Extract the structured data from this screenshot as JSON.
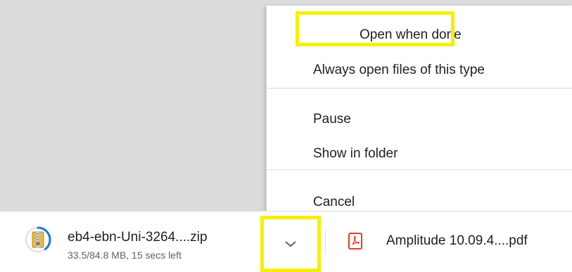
{
  "context_menu": {
    "items": [
      {
        "label": "Open when done"
      },
      {
        "label": "Always open files of this type"
      },
      {
        "label": "Pause"
      },
      {
        "label": "Show in folder"
      },
      {
        "label": "Cancel"
      }
    ]
  },
  "download_shelf": {
    "zip_item": {
      "filename": "eb4-ebn-Uni-3264....zip",
      "status": "33.5/84.8 MB, 15 secs left",
      "progress_fraction": 0.395,
      "icon": "zip-archive-icon"
    },
    "menu_toggle_icon": "chevron-down-icon",
    "pdf_item": {
      "filename": "Amplitude 10.09.4....pdf",
      "icon": "pdf-file-icon"
    }
  },
  "colors": {
    "highlight": "#f7ef00",
    "progress_ring": "#1a73e8",
    "pdf_red": "#e8392b",
    "backdrop": "#dcdcdc"
  }
}
